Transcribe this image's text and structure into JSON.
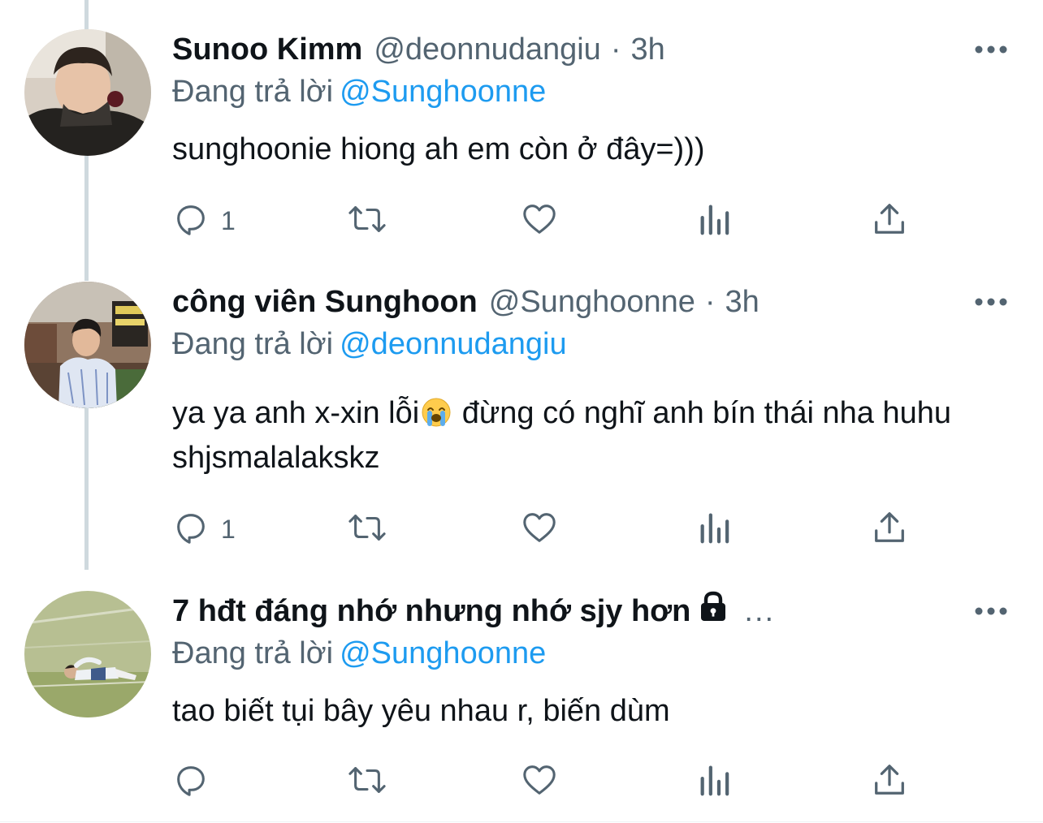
{
  "tweets": [
    {
      "name": "Sunoo Kimm",
      "handle": "@deonnudangiu",
      "separator": "·",
      "time": "3h",
      "replying_label": "Đang trả lời",
      "replying_to": "@Sunghoonne",
      "text_parts": [
        "sunghoonie hiong ah em còn ở đây=)))"
      ],
      "reply_count": "1"
    },
    {
      "name": "công viên Sunghoon",
      "handle": "@Sunghoonne",
      "separator": "·",
      "time": "3h",
      "replying_label": "Đang trả lời",
      "replying_to": "@deonnudangiu",
      "text_parts": [
        "ya ya anh x-xin lỗi",
        " đừng có nghĩ anh bín thái nha huhu shjsmalalakskz"
      ],
      "emoji": "loudly-crying-face-emoji",
      "reply_count": "1"
    },
    {
      "name": "7 hđt đáng nhớ nhưng nhớ sjy hơn",
      "name_truncation": "...",
      "protected_icon": "lock-icon",
      "replying_label": "Đang trả lời",
      "replying_to": "@Sunghoonne",
      "text_parts": [
        "tao biết tụi bây yêu nhau r, biến dùm"
      ],
      "reply_count": ""
    }
  ],
  "icons": {
    "reply": "reply-icon",
    "retweet": "retweet-icon",
    "like": "like-icon",
    "analytics": "analytics-icon",
    "share": "share-icon",
    "more": "more-icon"
  },
  "colors": {
    "text": "#0f1419",
    "secondary": "#536471",
    "link": "#1d9bf0",
    "thread_line": "#cfd9de"
  }
}
